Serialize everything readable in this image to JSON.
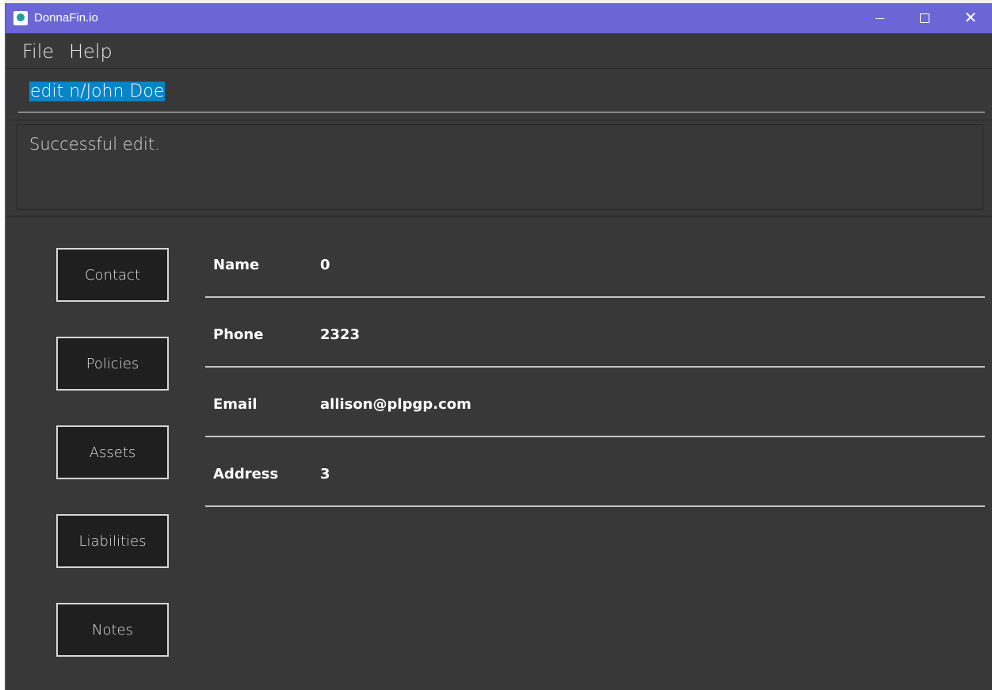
{
  "window": {
    "title": "DonnaFin.io"
  },
  "menu": {
    "items": [
      "File",
      "Help"
    ]
  },
  "command": {
    "value": "edit n/John Doe"
  },
  "result": {
    "text": "Successful edit."
  },
  "sidebar": {
    "buttons": [
      "Contact",
      "Policies",
      "Assets",
      "Liabilities",
      "Notes"
    ]
  },
  "contact": {
    "fields": [
      {
        "label": "Name",
        "value": "0"
      },
      {
        "label": "Phone",
        "value": "2323"
      },
      {
        "label": "Email",
        "value": "allison@plpgp.com"
      },
      {
        "label": "Address",
        "value": "3"
      }
    ]
  },
  "colors": {
    "titlebar": "#6b66d6",
    "background": "#383838",
    "selection": "#0a84c8"
  }
}
